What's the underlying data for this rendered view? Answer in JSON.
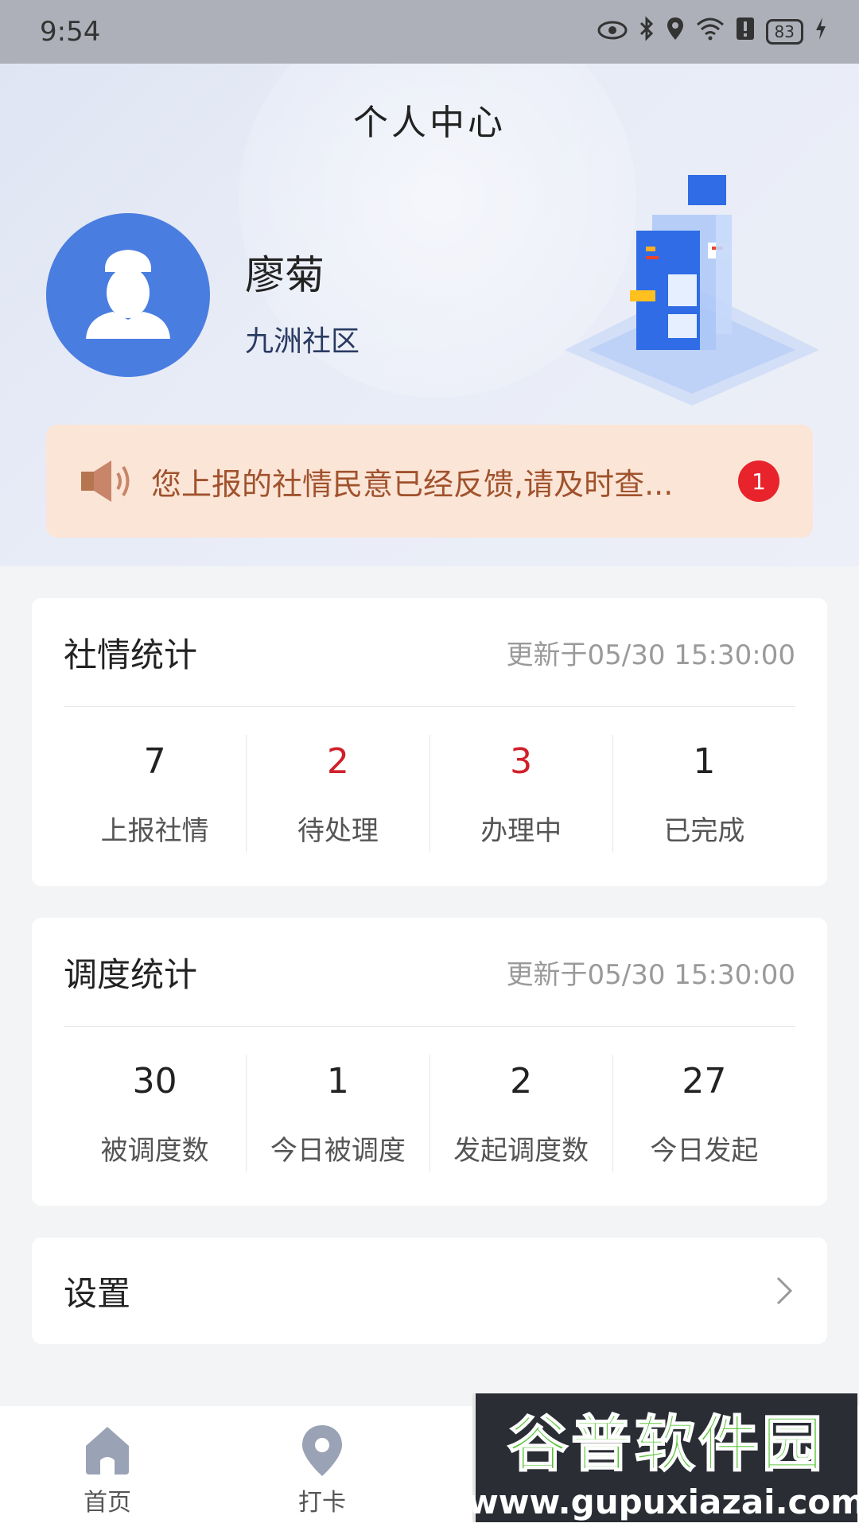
{
  "status_bar": {
    "time": "9:54",
    "battery": "83"
  },
  "header": {
    "title": "个人中心"
  },
  "profile": {
    "name": "廖菊",
    "community": "九洲社区"
  },
  "notice": {
    "text": "您上报的社情民意已经反馈,请及时查...",
    "badge": "1"
  },
  "social_stats": {
    "title": "社情统计",
    "updated": "更新于05/30 15:30:00",
    "items": [
      {
        "value": "7",
        "label": "上报社情",
        "highlight": false
      },
      {
        "value": "2",
        "label": "待处理",
        "highlight": true
      },
      {
        "value": "3",
        "label": "办理中",
        "highlight": true
      },
      {
        "value": "1",
        "label": "已完成",
        "highlight": false
      }
    ]
  },
  "dispatch_stats": {
    "title": "调度统计",
    "updated": "更新于05/30 15:30:00",
    "items": [
      {
        "value": "30",
        "label": "被调度数"
      },
      {
        "value": "1",
        "label": "今日被调度"
      },
      {
        "value": "2",
        "label": "发起调度数"
      },
      {
        "value": "27",
        "label": "今日发起"
      }
    ]
  },
  "settings": {
    "label": "设置"
  },
  "tabbar": {
    "items": [
      {
        "label": "首页",
        "icon": "home-icon"
      },
      {
        "label": "打卡",
        "icon": "location-pin-icon"
      }
    ]
  },
  "watermark": {
    "title": "谷普软件园",
    "url": "www.gupuxiazai.com"
  },
  "colors": {
    "accent_blue": "#4a7de0",
    "alert_red": "#d1202a",
    "notice_bg": "#fbe5d6",
    "notice_text": "#a0522d"
  }
}
